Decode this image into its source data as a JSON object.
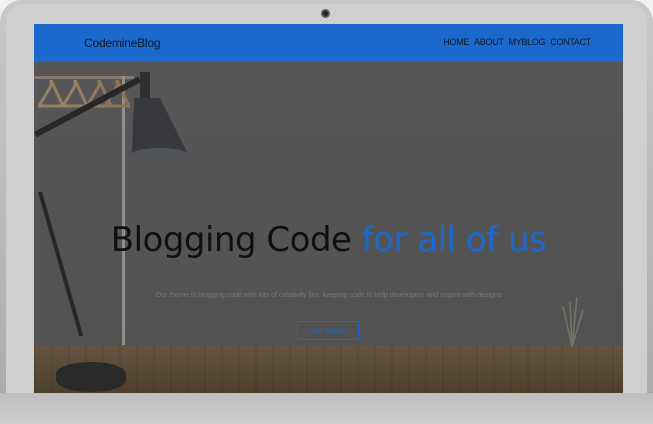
{
  "navbar": {
    "brand": "CodemineBlog",
    "links": [
      "HOME",
      "ABOUT",
      "MYBLOG",
      "CONTACT"
    ]
  },
  "hero": {
    "title_main": "Blogging Code",
    "title_accent": "for all of us",
    "subtitle": "Our theme is blogging code with lots of creativity like. keeping code to help developers and inspire with designs",
    "cta_label": "Get Action"
  },
  "colors": {
    "accent": "#1e6fd9",
    "navbar": "#1e6fd9",
    "hero_overlay": "#585858",
    "bezel": "#c4c4c4"
  },
  "icons": [
    "camera-icon",
    "desk-lamp-icon",
    "clothes-rack-icon",
    "plant-icon"
  ]
}
